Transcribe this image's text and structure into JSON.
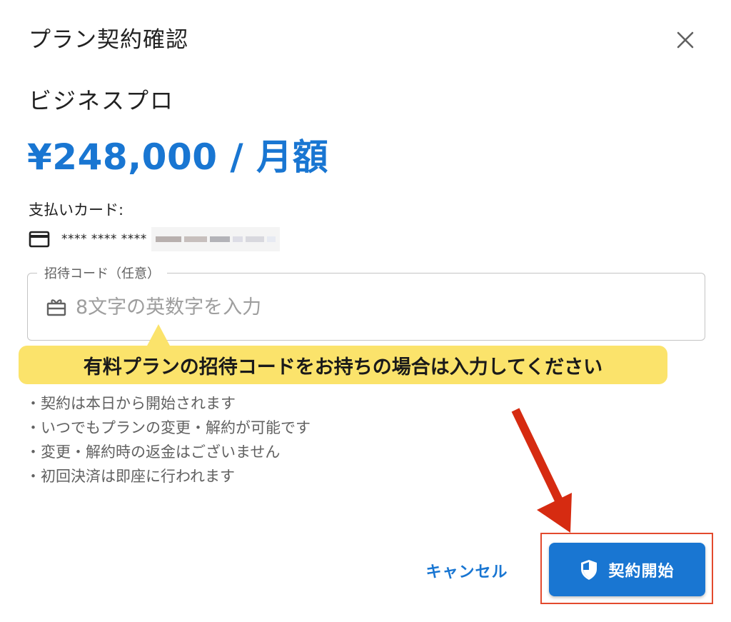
{
  "dialog": {
    "title": "プラン契約確認",
    "close_icon": "close-icon"
  },
  "plan": {
    "name": "ビジネスプロ",
    "price": "¥248,000 / 月額"
  },
  "payment": {
    "label": "支払いカード:",
    "card_icon": "credit-card-icon",
    "masked_number": "**** **** ****"
  },
  "invite_code": {
    "label": "招待コード（任意）",
    "placeholder": "8文字の英数字を入力",
    "value": "",
    "icon": "gift-icon"
  },
  "callout": {
    "text": "有料プランの招待コードをお持ちの場合は入力してください",
    "color": "#fbe36b"
  },
  "notes": [
    "契約は本日から開始されます",
    "いつでもプランの変更・解約が可能です",
    "変更・解約時の返金はございません",
    "初回決済は即座に行われます"
  ],
  "actions": {
    "cancel_label": "キャンセル",
    "start_label": "契約開始",
    "start_icon": "shield-icon"
  },
  "colors": {
    "accent": "#1976d2",
    "annotation": "#e34a2e"
  }
}
